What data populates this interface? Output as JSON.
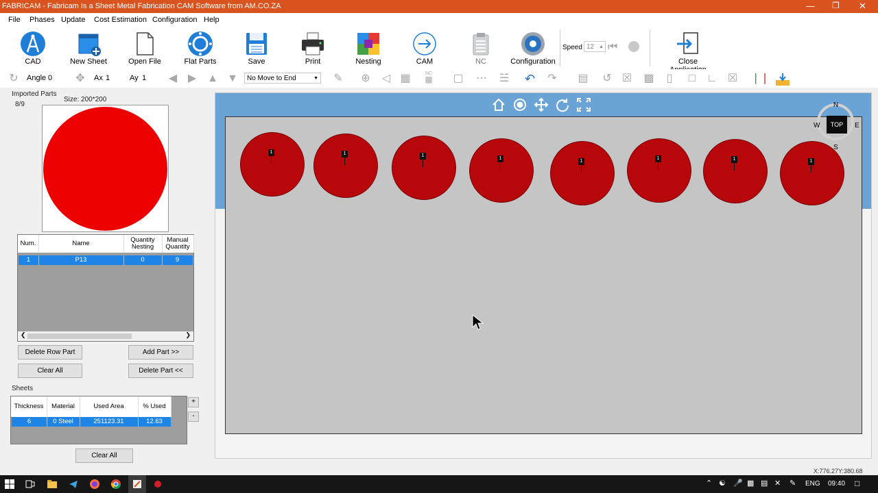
{
  "window": {
    "title": "FABRICAM - Fabricam Is a Sheet Metal Fabrication CAM Software from AM.CO.ZA"
  },
  "menu": [
    "File",
    "Phases",
    "Update",
    "Cost Estimation",
    "Configuration",
    "Help"
  ],
  "ribbon": {
    "cad": "CAD",
    "new_sheet": "New Sheet",
    "open_file": "Open File",
    "flat_parts": "Flat Parts",
    "save": "Save",
    "print": "Print",
    "nesting": "Nesting",
    "cam": "CAM",
    "nc": "NC",
    "configuration": "Configuration",
    "speed_label": "Speed",
    "speed_value": "12",
    "close_app": "Close Application"
  },
  "toolbar2": {
    "angle_label": "Angle",
    "angle_value": "0",
    "ax_label": "Ax",
    "ax_value": "1",
    "ay_label": "Ay",
    "ay_value": "1",
    "move_select": "No Move to End",
    "nc_badge": "NC"
  },
  "imported_parts": {
    "label": "Imported Parts",
    "count": "8/9",
    "size": "Size: 200*200",
    "preview_color": "#ee0000"
  },
  "parts_table": {
    "headers": [
      "Num.",
      "Name",
      "Quantity Nesting",
      "Manual Quantity"
    ],
    "rows": [
      {
        "num": "1",
        "name": "P13",
        "qty_nesting": "0",
        "manual_qty": "9"
      }
    ]
  },
  "part_buttons": {
    "delete_row": "Delete Row Part",
    "add_part": "Add Part >>",
    "clear_all": "Clear All",
    "delete_part": "Delete Part <<"
  },
  "sheets": {
    "label": "Sheets",
    "headers": [
      "Thickness",
      "Material",
      "Used Area",
      "% Used"
    ],
    "rows": [
      {
        "thickness": "6",
        "material": "0  Steel",
        "used_area": "251123.31",
        "used_pct": "12.63"
      }
    ],
    "plus": "+",
    "minus": "-",
    "clear_all": "Clear All"
  },
  "compass": {
    "n": "N",
    "s": "S",
    "e": "E",
    "w": "W",
    "top": "TOP"
  },
  "nested_parts": [
    {
      "label": "1"
    },
    {
      "label": "1"
    },
    {
      "label": "1"
    },
    {
      "label": "1"
    },
    {
      "label": "1"
    },
    {
      "label": "1"
    },
    {
      "label": "1"
    },
    {
      "label": "1"
    }
  ],
  "status": {
    "coords": "X:776.27Y:380.68"
  },
  "taskbar": {
    "lang": "ENG",
    "time": "09:40"
  },
  "colors": {
    "title_bar": "#d9531e",
    "selection": "#1e84e6",
    "part_fill": "#b8070b",
    "view_band": "#6aa4d6"
  }
}
